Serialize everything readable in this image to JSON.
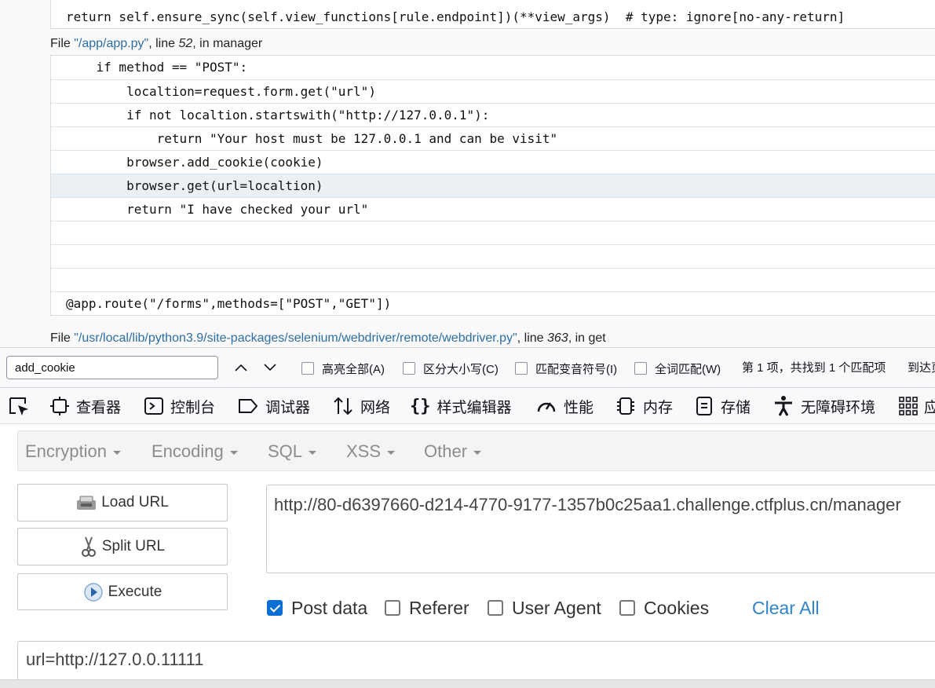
{
  "traceback": {
    "frame1_line": "return self.ensure_sync(self.view_functions[rule.endpoint])(**view_args)  # type: ignore[no-any-return]",
    "file2": {
      "prefix": "File ",
      "path": "\"/app/app.py\"",
      "line_label": ", line ",
      "lineno": "52",
      "in_label": ", in ",
      "func": "manager"
    },
    "frame2_lines": [
      "    if method == \"POST\":",
      "        localtion=request.form.get(\"url\")",
      "        if not localtion.startswith(\"http://127.0.0.1\"):",
      "            return \"Your host must be 127.0.0.1 and can be visit\"",
      "        browser.add_cookie(cookie)",
      "        browser.get(url=localtion)",
      "        return \"I have checked your url\"",
      "",
      "",
      "",
      "@app.route(\"/forms\",methods=[\"POST\",\"GET\"])"
    ],
    "file3": {
      "prefix": "File ",
      "path": "\"/usr/local/lib/python3.9/site-packages/selenium/webdriver/remote/webdriver.py\"",
      "line_label": ", line ",
      "lineno": "363",
      "in_label": ", in ",
      "func": "get"
    }
  },
  "findbar": {
    "query": "add_cookie",
    "options": [
      "高亮全部(A)",
      "区分大小写(C)",
      "匹配变音符号(I)",
      "全词匹配(W)"
    ],
    "status": "第 1 项，共找到 1 个匹配项",
    "status_next": "到达页"
  },
  "devtools": {
    "tabs": [
      {
        "label": "查看器",
        "icon": "inspector-icon"
      },
      {
        "label": "控制台",
        "icon": "console-icon"
      },
      {
        "label": "调试器",
        "icon": "debugger-icon"
      },
      {
        "label": "网络",
        "icon": "network-icon"
      },
      {
        "label": "样式编辑器",
        "icon": "style-editor-icon"
      },
      {
        "label": "性能",
        "icon": "performance-icon"
      },
      {
        "label": "内存",
        "icon": "memory-icon"
      },
      {
        "label": "存储",
        "icon": "storage-icon"
      },
      {
        "label": "无障碍环境",
        "icon": "accessibility-icon"
      },
      {
        "label": "应",
        "icon": "apps-grid-icon"
      }
    ]
  },
  "hackbar": {
    "menu": [
      "Encryption",
      "Encoding",
      "SQL",
      "XSS",
      "Other"
    ],
    "buttons": {
      "load": "Load URL",
      "split": "Split URL",
      "execute": "Execute"
    },
    "url": "http://80-d6397660-d214-4770-9177-1357b0c25aa1.challenge.ctfplus.cn/manager",
    "checks": [
      {
        "label": "Post data",
        "checked": true
      },
      {
        "label": "Referer",
        "checked": false
      },
      {
        "label": "User Agent",
        "checked": false
      },
      {
        "label": "Cookies",
        "checked": false
      }
    ],
    "clear_all": "Clear All",
    "post_body": "url=http://127.0.0.11111"
  },
  "colors": {
    "link": "#2d6ea3",
    "accent": "#0b6fd6",
    "clear_all": "#3183c8"
  }
}
